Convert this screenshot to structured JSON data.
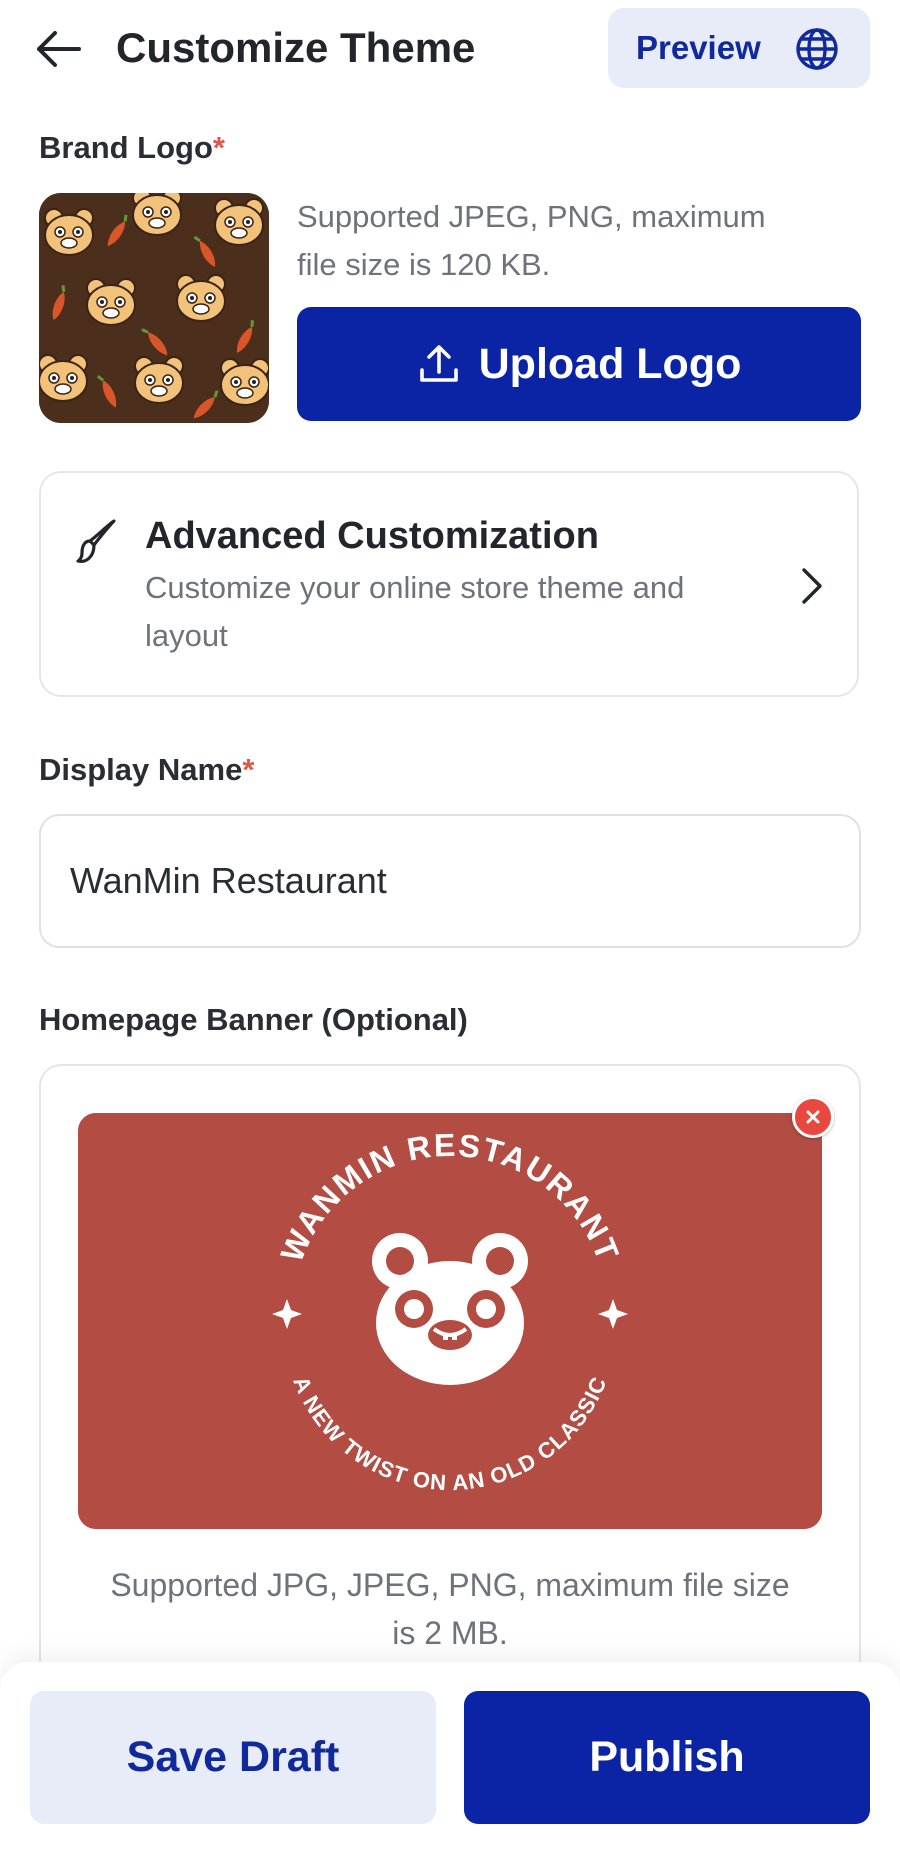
{
  "header": {
    "title": "Customize Theme",
    "preview_label": "Preview",
    "back_icon": "arrow-left-icon",
    "preview_icon": "globe-icon"
  },
  "brand_logo": {
    "label": "Brand Logo",
    "required_mark": "*",
    "hint_line1": "Supported JPEG, PNG, maximum",
    "hint_line2": "file size is 120 KB.",
    "upload_label": "Upload Logo",
    "upload_icon": "upload-icon"
  },
  "advanced": {
    "title": "Advanced Customization",
    "description_line1": "Customize your online store theme and",
    "description_line2": "layout",
    "icon": "brush-icon",
    "chevron": "chevron-right-icon"
  },
  "display_name": {
    "label": "Display Name",
    "required_mark": "*",
    "value": "WanMin Restaurant"
  },
  "banner": {
    "label": "Homepage Banner (Optional)",
    "logo_top_text": "WANMIN RESTAURANT",
    "logo_bottom_text": "A NEW TWIST ON AN OLD CLASSIC",
    "hint_line1": "Supported JPG, JPEG, PNG, maximum file size",
    "hint_line2": "is 2 MB.",
    "remove_icon": "close-icon"
  },
  "footer": {
    "save_label": "Save Draft",
    "publish_label": "Publish"
  },
  "colors": {
    "primary": "#0b24a6",
    "secondary_bg": "#e8ebf8",
    "required": "#e2574c",
    "banner_bg": "#b34c43"
  }
}
